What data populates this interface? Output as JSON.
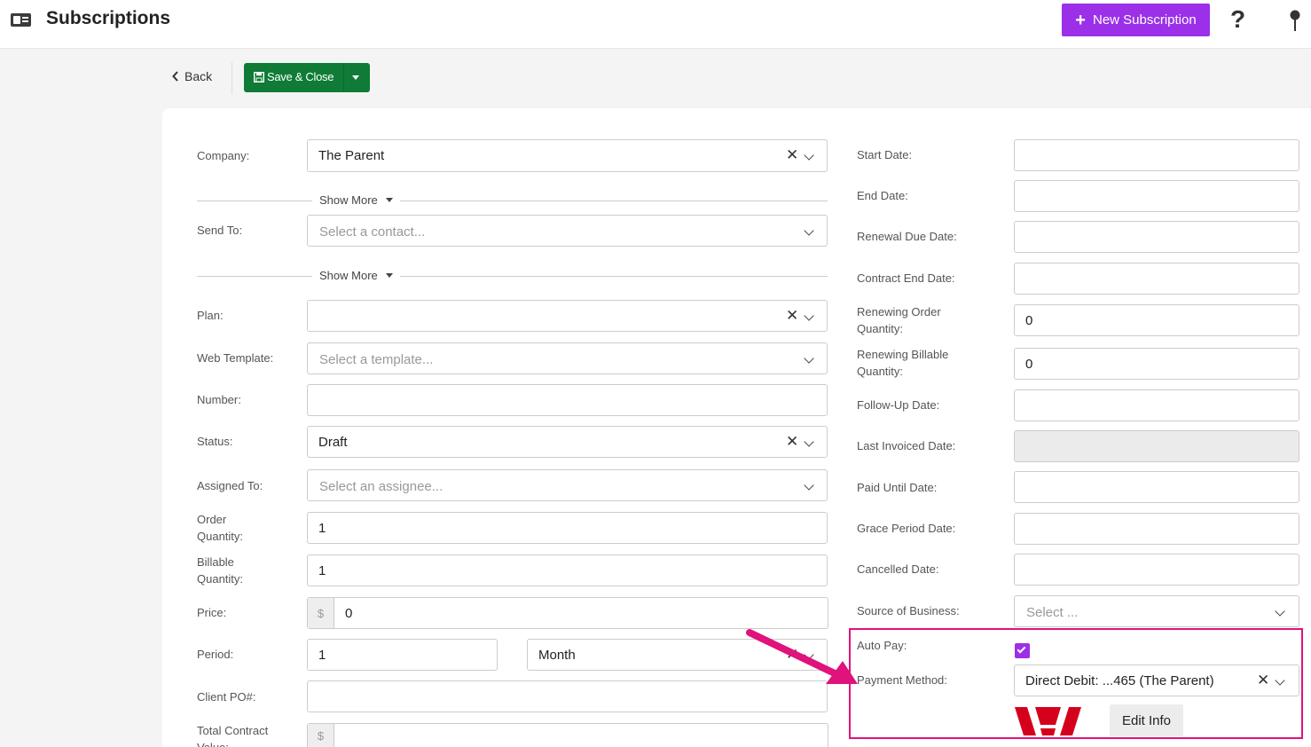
{
  "header": {
    "title": "Subscriptions",
    "new_button": "New Subscription",
    "help_glyph": "?"
  },
  "toolbar": {
    "back_label": "Back",
    "save_label": "Save & Close"
  },
  "left_form": {
    "company": {
      "label": "Company:",
      "value": "The Parent"
    },
    "show_more_1": "Show More",
    "send_to": {
      "label": "Send To:",
      "placeholder": "Select a contact..."
    },
    "show_more_2": "Show More",
    "plan": {
      "label": "Plan:",
      "value": ""
    },
    "web_template": {
      "label": "Web Template:",
      "placeholder": "Select a template..."
    },
    "number": {
      "label": "Number:",
      "value": ""
    },
    "status": {
      "label": "Status:",
      "value": "Draft"
    },
    "assigned_to": {
      "label": "Assigned To:",
      "placeholder": "Select an assignee..."
    },
    "order_quantity": {
      "label_1": "Order",
      "label_2": "Quantity:",
      "value": "1"
    },
    "billable_quantity": {
      "label_1": "Billable",
      "label_2": "Quantity:",
      "value": "1"
    },
    "price": {
      "label": "Price:",
      "currency": "$",
      "value": "0"
    },
    "period": {
      "label": "Period:",
      "value": "1",
      "unit": "Month"
    },
    "client_po": {
      "label": "Client PO#:",
      "value": ""
    },
    "total_contract_value": {
      "label_1": "Total Contract",
      "label_2": "Value:",
      "currency": "$",
      "value": ""
    }
  },
  "right_form": {
    "start_date": {
      "label": "Start Date:",
      "value": ""
    },
    "end_date": {
      "label": "End Date:",
      "value": ""
    },
    "renewal_due_date": {
      "label": "Renewal Due Date:",
      "value": ""
    },
    "contract_end_date": {
      "label": "Contract End Date:",
      "value": ""
    },
    "renewing_order_quantity": {
      "label_1": "Renewing Order",
      "label_2": "Quantity:",
      "value": "0"
    },
    "renewing_billable_quantity": {
      "label_1": "Renewing Billable",
      "label_2": "Quantity:",
      "value": "0"
    },
    "follow_up_date": {
      "label": "Follow-Up Date:",
      "value": ""
    },
    "last_invoiced_date": {
      "label": "Last Invoiced Date:",
      "value": ""
    },
    "paid_until_date": {
      "label": "Paid Until Date:",
      "value": ""
    },
    "grace_period_date": {
      "label": "Grace Period Date:",
      "value": ""
    },
    "cancelled_date": {
      "label": "Cancelled Date:",
      "value": ""
    },
    "source_of_business": {
      "label": "Source of Business:",
      "placeholder": "Select ..."
    },
    "auto_pay": {
      "label": "Auto Pay:",
      "checked": true
    },
    "payment_method": {
      "label": "Payment Method:",
      "value": "Direct Debit: ...465 (The Parent)"
    },
    "edit_info_label": "Edit Info"
  },
  "colors": {
    "accent_purple": "#9b30e8",
    "save_green": "#0f7b36",
    "highlight_pink": "#e0127b",
    "bank_red": "#d5001c"
  }
}
